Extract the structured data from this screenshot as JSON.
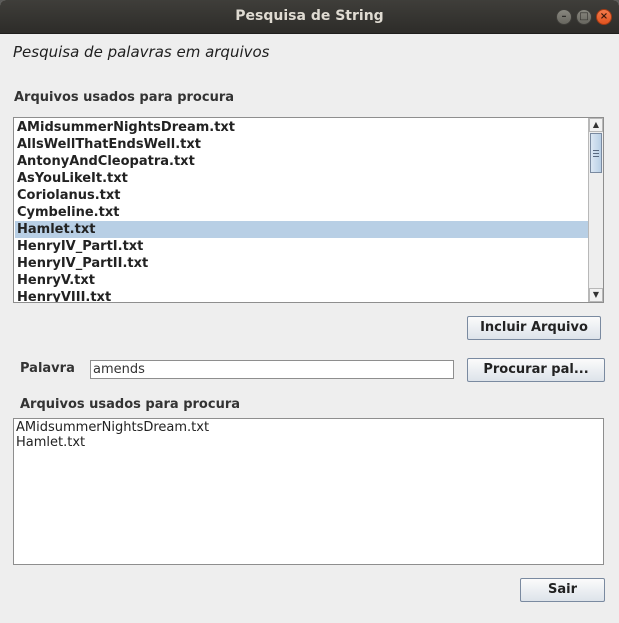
{
  "window": {
    "title": "Pesquisa de String"
  },
  "heading": "Pesquisa de palavras em arquivos",
  "files_section": {
    "label": "Arquivos usados para procura",
    "items": [
      "AMidsummerNightsDream.txt",
      "AllsWellThatEndsWell.txt",
      "AntonyAndCleopatra.txt",
      "AsYouLikeIt.txt",
      "Coriolanus.txt",
      "Cymbeline.txt",
      "Hamlet.txt",
      "HenryIV_PartI.txt",
      "HenryIV_PartII.txt",
      "HenryV.txt",
      "HenryVIII.txt"
    ],
    "selected": "Hamlet.txt"
  },
  "include_button": "Incluir Arquivo",
  "search": {
    "label": "Palavra",
    "value": "amends",
    "button": "Procurar pal..."
  },
  "results_section": {
    "label": "Arquivos usados para procura",
    "lines": [
      "AMidsummerNightsDream.txt",
      "Hamlet.txt"
    ]
  },
  "exit_button": "Sair",
  "colors": {
    "selection": "#b8cfe5",
    "close_button": "#e95420"
  }
}
